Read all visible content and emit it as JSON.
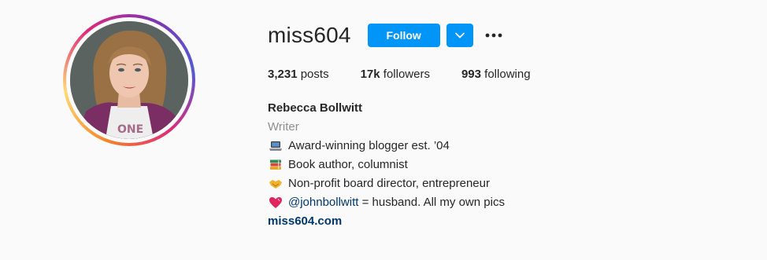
{
  "profile": {
    "username": "miss604",
    "follow_label": "Follow",
    "stats": {
      "posts_count": "3,231",
      "posts_label": "posts",
      "followers_count": "17k",
      "followers_label": "followers",
      "following_count": "993",
      "following_label": "following"
    },
    "full_name": "Rebecca Bollwitt",
    "category": "Writer",
    "bio": [
      {
        "icon": "laptop-icon",
        "text": "Award-winning blogger est. ’04"
      },
      {
        "icon": "books-icon",
        "text": "Book author, columnist"
      },
      {
        "icon": "handshake-icon",
        "text": "Non-profit board director, entrepreneur"
      },
      {
        "icon": "heart-icon",
        "mention": "@johnbollwitt",
        "text": " = husband. All my own pics"
      }
    ],
    "website": "miss604.com"
  },
  "colors": {
    "primary_button": "#0095f6",
    "link": "#00376b",
    "muted_text": "#8e8e8e"
  }
}
